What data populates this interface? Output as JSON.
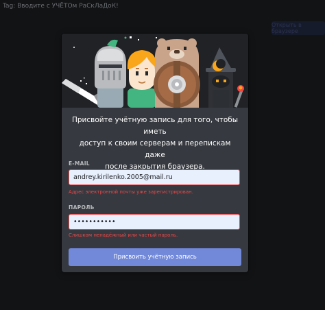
{
  "window": {
    "title": "Tag: Вводите с УЧЁТОм РаСкЛаДоК!"
  },
  "topbar": {
    "button_label": "Открыть в браузере"
  },
  "modal": {
    "description_lines": [
      "Присвойте учётную запись для того, чтобы иметь",
      "доступ к своим серверам и перепискам даже",
      "после закрытия браузера."
    ],
    "email": {
      "label": "E-MAIL",
      "value": "andrey.kirilenko.2005@mail.ru",
      "error": "Адрес электронной почты уже зарегистрирован."
    },
    "password": {
      "label": "ПАРОЛЬ",
      "value": "•••••••••••",
      "error": "Слишком ненадёжный или частый пароль."
    },
    "submit_label": "Присвоить учётную запись"
  },
  "colors": {
    "background": "#121315",
    "modal": "#36393f",
    "hero": "#202225",
    "accent": "#7289da",
    "error": "#f04747",
    "input_bg": "#e8f0fe"
  },
  "illustration": [
    "knight-character",
    "blonde-character",
    "bear-with-shield-character",
    "wizard-character",
    "sword",
    "torch",
    "moon"
  ]
}
